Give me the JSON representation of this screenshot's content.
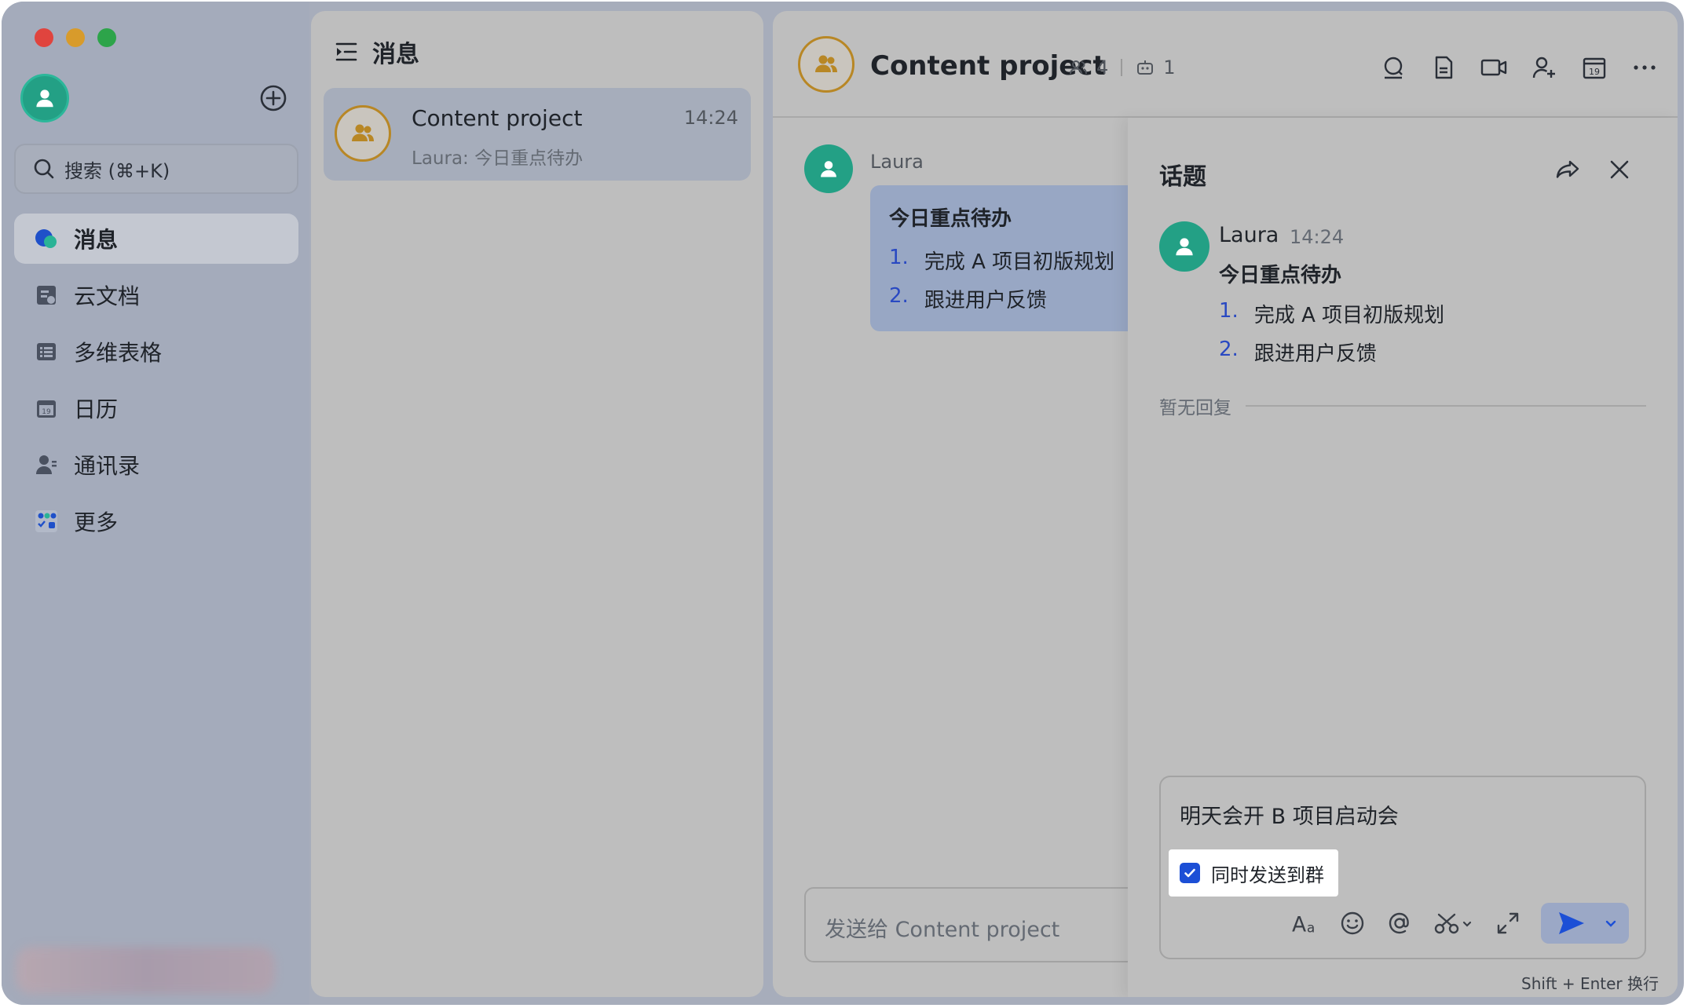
{
  "sidebar": {
    "search_placeholder": "搜索 (⌘+K)",
    "items": [
      {
        "label": "消息",
        "icon": "message-icon",
        "active": true
      },
      {
        "label": "云文档",
        "icon": "cloud-doc-icon",
        "active": false
      },
      {
        "label": "多维表格",
        "icon": "base-table-icon",
        "active": false
      },
      {
        "label": "日历",
        "icon": "calendar-icon",
        "active": false
      },
      {
        "label": "通讯录",
        "icon": "contacts-icon",
        "active": false
      },
      {
        "label": "更多",
        "icon": "more-apps-icon",
        "active": false
      }
    ]
  },
  "message_list": {
    "header": "消息",
    "conversations": [
      {
        "title": "Content project",
        "time": "14:24",
        "preview": "Laura: 今日重点待办"
      }
    ]
  },
  "chat": {
    "title": "Content project",
    "member_count": "4",
    "bot_count": "1",
    "header_icons": [
      "search-icon",
      "doc-icon",
      "video-call-icon",
      "add-member-icon",
      "calendar-icon",
      "more-icon"
    ],
    "message": {
      "sender": "Laura",
      "title": "今日重点待办",
      "items": [
        {
          "num": "1.",
          "text": "完成 A 项目初版规划"
        },
        {
          "num": "2.",
          "text": "跟进用户反馈"
        }
      ]
    },
    "input_placeholder": "发送给 Content project"
  },
  "thread": {
    "title": "话题",
    "message": {
      "sender": "Laura",
      "time": "14:24",
      "title": "今日重点待办",
      "items": [
        {
          "num": "1.",
          "text": "完成 A 项目初版规划"
        },
        {
          "num": "2.",
          "text": "跟进用户反馈"
        }
      ]
    },
    "no_reply": "暂无回复",
    "composer_text": "明天会开 B 项目启动会",
    "also_send_label": "同时发送到群",
    "also_send_checked": true,
    "hint": "Shift + Enter 换行"
  },
  "colors": {
    "accent": "#1c4fd6",
    "avatar_green": "#23a085",
    "group_ring": "#b88725"
  }
}
